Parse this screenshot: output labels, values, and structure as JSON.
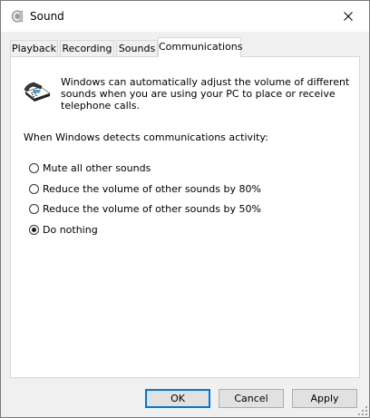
{
  "window": {
    "title": "Sound",
    "accent_color": "#0078d7"
  },
  "tabs": [
    {
      "label": "Playback",
      "active": false
    },
    {
      "label": "Recording",
      "active": false
    },
    {
      "label": "Sounds",
      "active": false
    },
    {
      "label": "Communications",
      "active": true
    }
  ],
  "communications": {
    "icon": "telephone-icon",
    "description": "Windows can automatically adjust the volume of different sounds when you are using your PC to place or receive telephone calls.",
    "detect_label": "When Windows detects communications activity:",
    "options": [
      {
        "label": "Mute all other sounds",
        "checked": false
      },
      {
        "label": "Reduce the volume of other sounds by 80%",
        "checked": false
      },
      {
        "label": "Reduce the volume of other sounds by 50%",
        "checked": false
      },
      {
        "label": "Do nothing",
        "checked": true
      }
    ]
  },
  "buttons": {
    "ok": "OK",
    "cancel": "Cancel",
    "apply": "Apply"
  }
}
